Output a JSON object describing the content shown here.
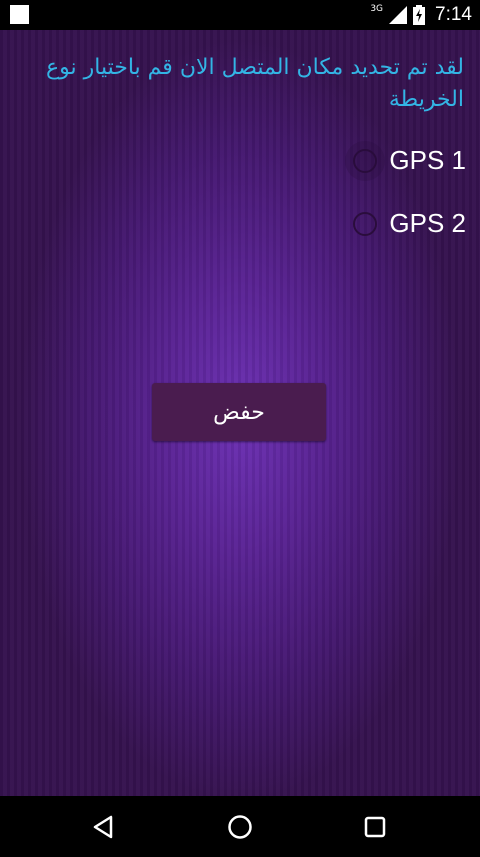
{
  "status_bar": {
    "network": "3G",
    "time": "7:14"
  },
  "main": {
    "message": "لقد تم تحديد مكان المتصل الان قم باختيار نوع الخريطة",
    "options": [
      {
        "label": "GPS 1",
        "selected": false
      },
      {
        "label": "GPS 2",
        "selected": false
      }
    ],
    "save_label": "حفض"
  },
  "colors": {
    "message_text": "#33b5e5",
    "button_bg": "#4a1c4f",
    "background_center": "#6c30b4",
    "background_edge": "#35124f"
  },
  "icons": {
    "status": [
      "app-notification-icon",
      "signal-icon",
      "battery-charging-icon"
    ],
    "nav": [
      "back-icon",
      "home-icon",
      "recents-icon"
    ]
  }
}
